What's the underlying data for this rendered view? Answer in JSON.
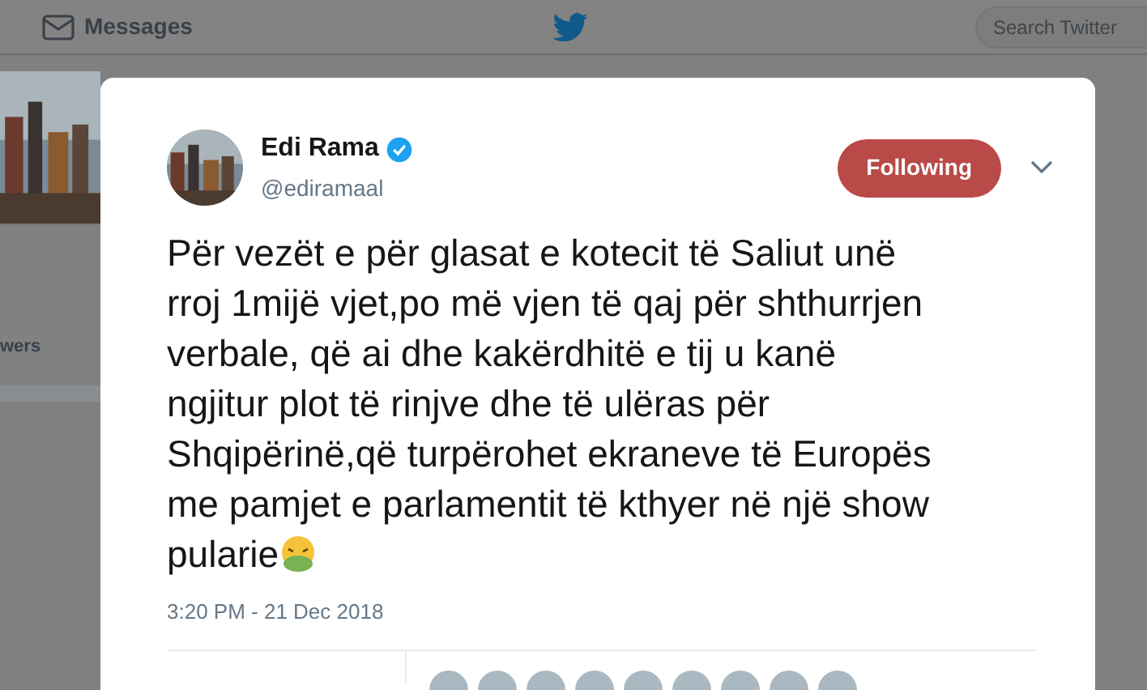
{
  "top_bar": {
    "messages_label": "Messages",
    "search": {
      "placeholder": "Search Twitter"
    }
  },
  "profile_card": {
    "followers_label": "wers"
  },
  "tweet": {
    "name": "Edi Rama",
    "verified": true,
    "handle": "@ediramaal",
    "follow_button": {
      "label": "Following",
      "selected": true
    },
    "text": "Për vezët e për glasat e kotecit të Saliut unë rroj 1mijë vjet,po më vjen të qaj për shthurrjen verbale, që ai dhe kakërdhitë e tij u kanë ngjitur plot të rinjve dhe të ulëras për Shqipërinë,që turpërohet ekraneve të Europës me pamjet e parlamentit të kthyer në një show pularie",
    "timestamp": "3:20 PM - 21 Dec 2018"
  }
}
